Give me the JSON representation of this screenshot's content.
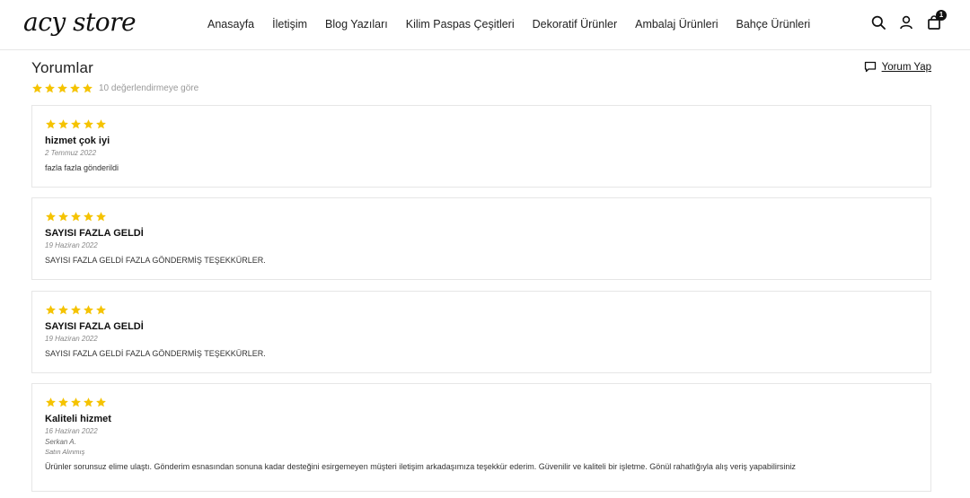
{
  "store": {
    "logo": "acy store"
  },
  "nav": [
    "Anasayfa",
    "İletişim",
    "Blog Yazıları",
    "Kilim Paspas Çeşitleri",
    "Dekoratif Ürünler",
    "Ambalaj Ürünleri",
    "Bahçe Ürünleri"
  ],
  "header_icons": {
    "search": "search-icon",
    "account": "user-icon",
    "cart": "shopping-bag-icon",
    "cart_count": "1"
  },
  "reviews": {
    "title": "Yorumlar",
    "rating": 5,
    "summary": "10 değerlendirmeye göre",
    "write_review_label": "Yorum Yap",
    "star_color": "#f5c300",
    "items": [
      {
        "rating": 5,
        "title": "hizmet çok iyi",
        "date": "2 Temmuz 2022",
        "author": "",
        "badge": "",
        "body": "fazla fazla gönderildi"
      },
      {
        "rating": 5,
        "title": "SAYISI FAZLA GELDİ",
        "date": "19 Haziran 2022",
        "author": "",
        "badge": "",
        "body": "SAYISI FAZLA GELDİ FAZLA GÖNDERMİŞ TEŞEKKÜRLER."
      },
      {
        "rating": 5,
        "title": "SAYISI FAZLA GELDİ",
        "date": "19 Haziran 2022",
        "author": "",
        "badge": "",
        "body": "SAYISI FAZLA GELDİ FAZLA GÖNDERMİŞ TEŞEKKÜRLER."
      },
      {
        "rating": 5,
        "title": "Kaliteli hizmet",
        "date": "16 Haziran 2022",
        "author": "Serkan A.",
        "badge": "Satın Alınmış",
        "body": "Ürünler sorunsuz elime ulaştı. Gönderim esnasından sonuna kadar desteğini esirgemeyen müşteri iletişim arkadaşımıza teşekkür ederim. Güvenilir ve kaliteli bir işletme. Gönül rahatlığıyla alış veriş yapabilirsiniz"
      }
    ]
  }
}
